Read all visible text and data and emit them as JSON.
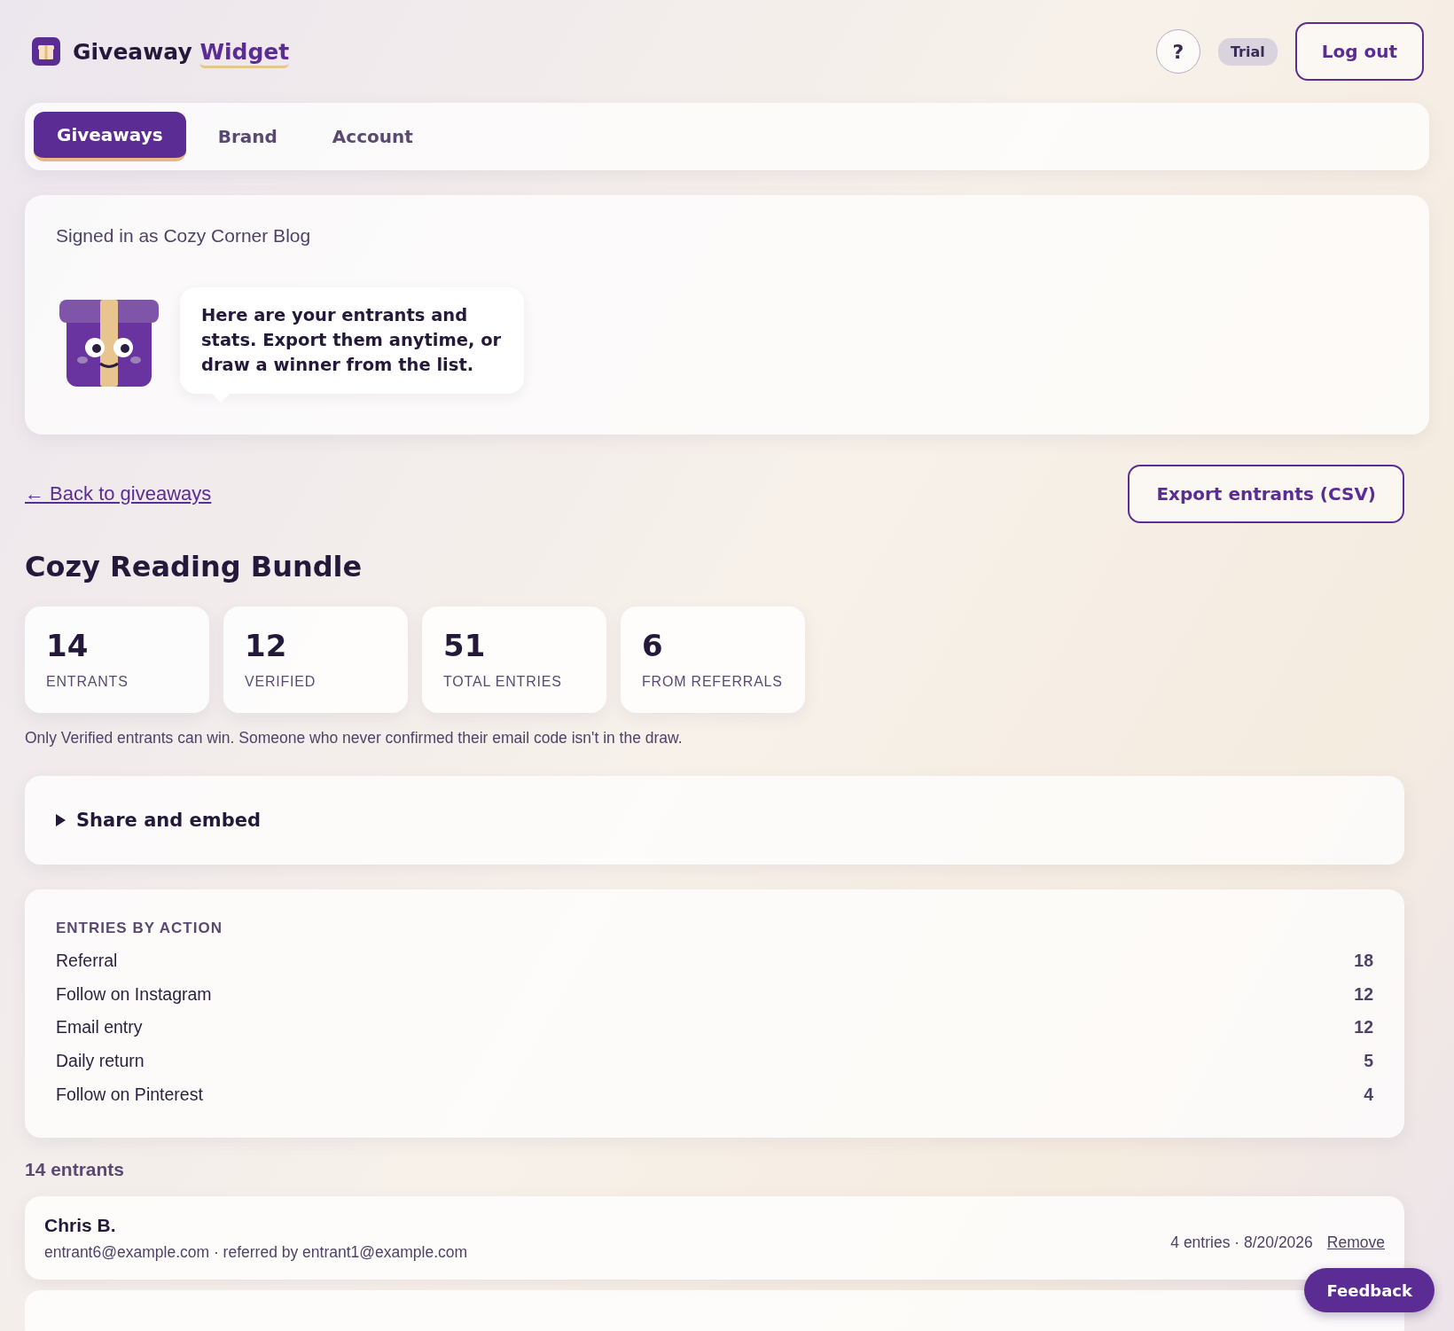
{
  "brand": {
    "name": "Giveaway",
    "highlight": "Widget"
  },
  "header": {
    "help": "?",
    "plan_badge": "Trial",
    "logout": "Log out"
  },
  "tabs": [
    {
      "label": "Giveaways",
      "selected": true
    },
    {
      "label": "Brand",
      "selected": false
    },
    {
      "label": "Account",
      "selected": false
    }
  ],
  "signed_in": "Signed in as Cozy Corner Blog",
  "mascot_message": "Here are your entrants and stats. Export them anytime, or draw a winner from the list.",
  "back_link": "← Back to giveaways",
  "export_button": "Export entrants (CSV)",
  "giveaway_title": "Cozy Reading Bundle",
  "stats": [
    {
      "value": "14",
      "label": "ENTRANTS"
    },
    {
      "value": "12",
      "label": "VERIFIED"
    },
    {
      "value": "51",
      "label": "TOTAL ENTRIES"
    },
    {
      "value": "6",
      "label": "FROM REFERRALS"
    }
  ],
  "note": "Only Verified entrants can win. Someone who never confirmed their email code isn't in the draw.",
  "share": {
    "label": "Share and embed",
    "expanded": false
  },
  "entries_by_action": {
    "heading": "ENTRIES BY ACTION",
    "rows": [
      {
        "action": "Referral",
        "count": "18"
      },
      {
        "action": "Follow on Instagram",
        "count": "12"
      },
      {
        "action": "Email entry",
        "count": "12"
      },
      {
        "action": "Daily return",
        "count": "5"
      },
      {
        "action": "Follow on Pinterest",
        "count": "4"
      }
    ]
  },
  "entrants_heading": "14 entrants",
  "entrants": [
    {
      "name": "Chris B.",
      "detail": "entrant6@example.com · referred by entrant1@example.com",
      "meta": "4 entries · 8/20/2026",
      "action": "Remove"
    }
  ],
  "feedback": "Feedback"
}
